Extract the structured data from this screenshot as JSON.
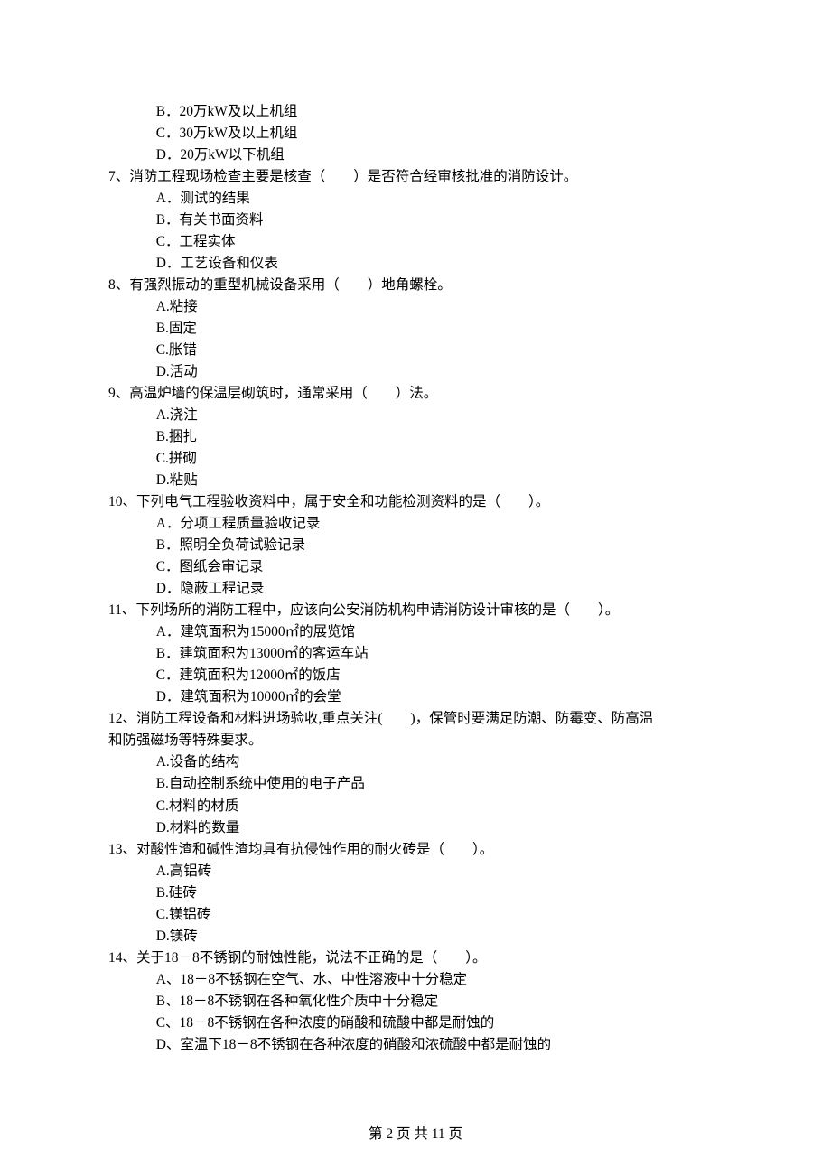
{
  "extraOptions": [
    "B．20万kW及以上机组",
    "C．30万kW及以上机组",
    "D．20万kW以下机组"
  ],
  "questions": [
    {
      "num": "7、",
      "stem": "消防工程现场检查主要是核查（　　）是否符合经审核批准的消防设计。",
      "options": [
        "A．测试的结果",
        "B．有关书面资料",
        "C．工程实体",
        "D．工艺设备和仪表"
      ]
    },
    {
      "num": "8、",
      "stem": "有强烈振动的重型机械设备采用（　　）地角螺栓。",
      "options": [
        "A.粘接",
        "B.固定",
        "C.胀错",
        "D.活动"
      ]
    },
    {
      "num": "9、",
      "stem": "高温炉墙的保温层砌筑时，通常采用（　　）法。",
      "options": [
        "A.浇注",
        "B.捆扎",
        "C.拼砌",
        "D.粘贴"
      ]
    },
    {
      "num": "10、",
      "stem": "下列电气工程验收资料中，属于安全和功能检测资料的是（　　）。",
      "options": [
        "A．分项工程质量验收记录",
        "B．照明全负荷试验记录",
        "C．图纸会审记录",
        "D．隐蔽工程记录"
      ]
    },
    {
      "num": "11、",
      "stem": "下列场所的消防工程中，应该向公安消防机构申请消防设计审核的是（　　）。",
      "options": [
        "A．建筑面积为15000㎡的展览馆",
        "B．建筑面积为13000㎡的客运车站",
        "C．建筑面积为12000㎡的饭店",
        "D．建筑面积为10000㎡的会堂"
      ]
    },
    {
      "num": "12、",
      "stem": "消防工程设备和材料进场验收,重点关注(　　)，保管时要满足防潮、防霉变、防高温",
      "stemCont": "和防强磁场等特殊要求。",
      "options": [
        "A.设备的结构",
        "B.自动控制系统中使用的电子产品",
        "C.材料的材质",
        "D.材料的数量"
      ]
    },
    {
      "num": "13、",
      "stem": "对酸性渣和碱性渣均具有抗侵蚀作用的耐火砖是（　　）。",
      "options": [
        "A.高铝砖",
        "B.硅砖",
        "C.镁铝砖",
        "D.镁砖"
      ]
    },
    {
      "num": "14、",
      "stem": "关于18－8不锈钢的耐蚀性能，说法不正确的是（　　）。",
      "options": [
        "A、18－8不锈钢在空气、水、中性溶液中十分稳定",
        "B、18－8不锈钢在各种氧化性介质中十分稳定",
        "C、18－8不锈钢在各种浓度的硝酸和硫酸中都是耐蚀的",
        "D、室温下18－8不锈钢在各种浓度的硝酸和浓硫酸中都是耐蚀的"
      ]
    }
  ],
  "footer": "第 2 页 共 11 页"
}
